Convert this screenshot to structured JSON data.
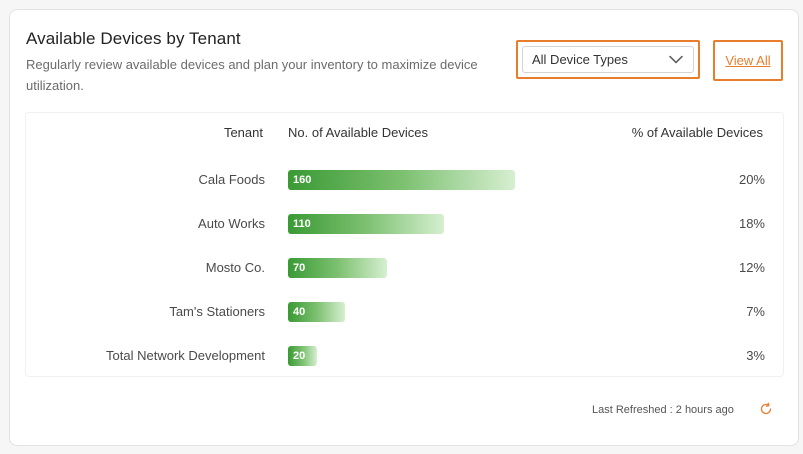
{
  "card": {
    "title": "Available Devices by Tenant",
    "subtitle": "Regularly review available devices and plan your inventory to maximize device utilization."
  },
  "filter": {
    "selected": "All Device Types",
    "icon": "chevron-down-icon"
  },
  "view_all_label": "View All",
  "table": {
    "headers": {
      "tenant": "Tenant",
      "devices": "No. of Available Devices",
      "percent": "% of Available Devices"
    },
    "rows": [
      {
        "tenant": "Cala Foods",
        "devices": 160,
        "devices_label": "160",
        "percent": "20%"
      },
      {
        "tenant": "Auto Works",
        "devices": 110,
        "devices_label": "110",
        "percent": "18%"
      },
      {
        "tenant": "Mosto Co.",
        "devices": 70,
        "devices_label": "70",
        "percent": "12%"
      },
      {
        "tenant": "Tam's Stationers",
        "devices": 40,
        "devices_label": "40",
        "percent": "7%"
      },
      {
        "tenant": "Total Network Development",
        "devices": 20,
        "devices_label": "20",
        "percent": "3%"
      }
    ]
  },
  "footer": {
    "last_refreshed": "Last Refreshed : 2 hours ago",
    "refresh_icon": "refresh-icon"
  },
  "colors": {
    "accent": "#e87d2d",
    "bar_dark": "#3a9a34",
    "bar_light": "#d6efd0"
  }
}
